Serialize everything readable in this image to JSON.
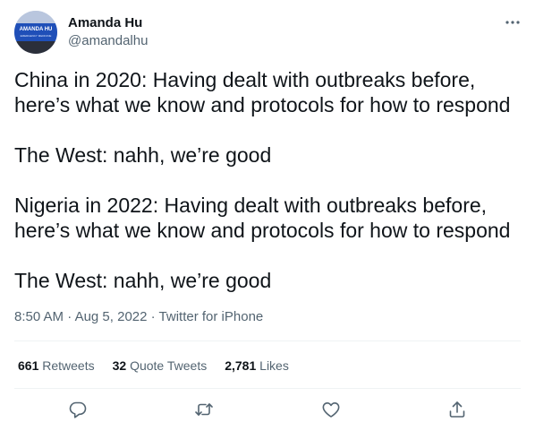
{
  "author": {
    "name": "Amanda Hu",
    "handle": "@amandalhu",
    "avatar_banner_text": "AMANDA HU",
    "avatar_sub_text": "EMERGENCY MEDICINE"
  },
  "tweet": {
    "paragraphs": [
      "China in 2020: Having dealt with outbreaks before,\nhere’s what we know and protocols for how to respond",
      "The West: nahh, we’re good",
      "Nigeria in 2022: Having dealt with outbreaks before,\nhere’s what we know and protocols for how to respond",
      "The West: nahh, we’re good"
    ]
  },
  "meta": {
    "time": "8:50 AM",
    "separator": " · ",
    "date": "Aug 5, 2022",
    "source": "Twitter for iPhone"
  },
  "stats": {
    "retweets_count": "661",
    "retweets_label": "Retweets",
    "quotes_count": "32",
    "quotes_label": "Quote Tweets",
    "likes_count": "2,781",
    "likes_label": "Likes"
  },
  "icons": {
    "more": "more-horizontal-icon",
    "reply": "reply-icon",
    "retweet": "retweet-icon",
    "like": "heart-icon",
    "share": "share-icon"
  },
  "colors": {
    "text": "#0f1419",
    "secondary": "#536471",
    "divider": "#eff3f4",
    "avatar_blue": "#1f4fb8"
  }
}
